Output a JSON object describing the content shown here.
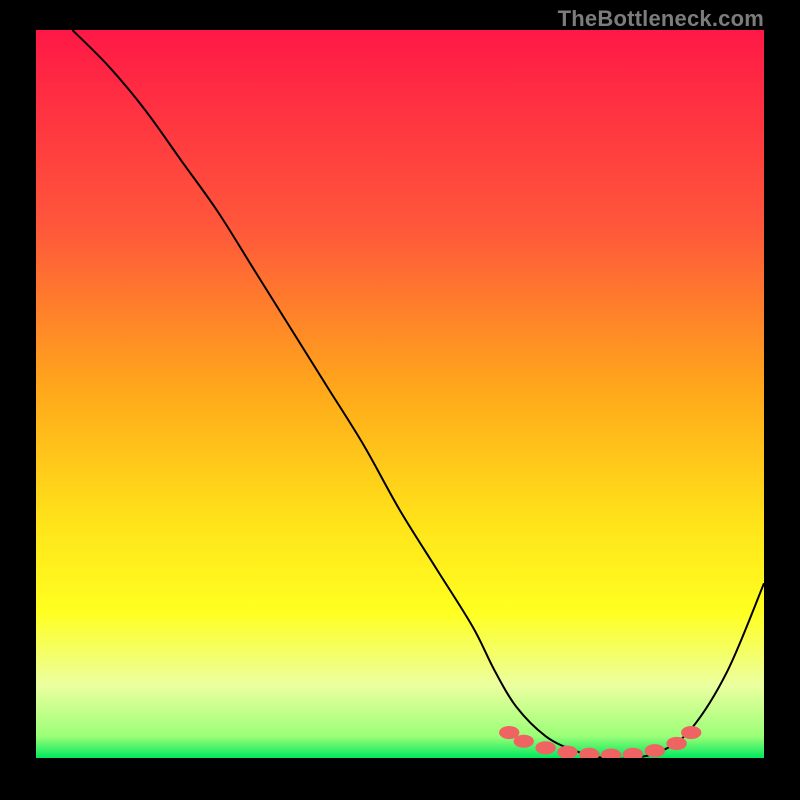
{
  "watermark": "TheBottleneck.com",
  "colors": {
    "black": "#000000",
    "curve": "#000000",
    "marker": "#ef6363",
    "grad_top": "#ff1846",
    "grad_mid1": "#ff7638",
    "grad_mid2": "#ffd41e",
    "grad_mid3": "#ffff20",
    "grad_mid4": "#eaffa6",
    "grad_bot": "#00e85e"
  },
  "chart_data": {
    "type": "line",
    "title": "",
    "xlabel": "",
    "ylabel": "",
    "xlim": [
      0,
      100
    ],
    "ylim": [
      0,
      100
    ],
    "gradient_stops": [
      {
        "offset": 0,
        "color": "#ff1846"
      },
      {
        "offset": 28,
        "color": "#ff5a3a"
      },
      {
        "offset": 50,
        "color": "#ffaa1a"
      },
      {
        "offset": 68,
        "color": "#ffe41a"
      },
      {
        "offset": 80,
        "color": "#ffff20"
      },
      {
        "offset": 90,
        "color": "#ecffa0"
      },
      {
        "offset": 97,
        "color": "#9cff78"
      },
      {
        "offset": 100,
        "color": "#00e85e"
      }
    ],
    "series": [
      {
        "name": "bottleneck-curve",
        "x": [
          5,
          10,
          15,
          20,
          25,
          30,
          35,
          40,
          45,
          50,
          55,
          60,
          63,
          66,
          70,
          74,
          78,
          82,
          86,
          90,
          95,
          100
        ],
        "y": [
          100,
          95,
          89,
          82,
          75,
          67,
          59,
          51,
          43,
          34,
          26,
          18,
          12,
          7,
          3,
          1,
          0,
          0,
          1,
          4,
          12,
          24
        ]
      }
    ],
    "markers": {
      "name": "optimal-zone-markers",
      "x": [
        65,
        67,
        70,
        73,
        76,
        79,
        82,
        85,
        88,
        90
      ],
      "y": [
        3.5,
        2.3,
        1.4,
        0.8,
        0.5,
        0.4,
        0.5,
        1.0,
        2.0,
        3.5
      ]
    },
    "annotations": []
  }
}
